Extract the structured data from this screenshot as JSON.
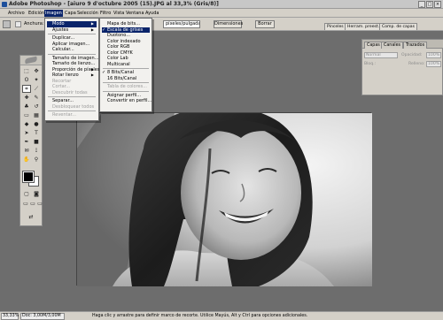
{
  "window": {
    "title": "Adobe Photoshop - [aiuro 9 d'octubre 2005 (15).JPG al 33,3% (Gris/8)]",
    "controls": [
      "_",
      "□",
      "×"
    ]
  },
  "menubar": [
    "Archivo",
    "Edición",
    "Imagen",
    "Capa",
    "Selección",
    "Filtro",
    "Vista",
    "Ventana",
    "Ayuda"
  ],
  "active_menu": "Imagen",
  "options_bar": {
    "anchura_label": "Anchura:",
    "resolution_unit": "píxeles/pulgada",
    "dimensions_button": "Dimensiones",
    "clear_button": "Borrar",
    "well_tabs": [
      "Pinceles",
      "Herram. preest.",
      "Comp. de capas"
    ]
  },
  "imagen_menu": [
    {
      "label": "Modo",
      "submenu": true,
      "highlighted": true
    },
    {
      "label": "Ajustes",
      "submenu": true
    },
    {
      "sep": true
    },
    {
      "label": "Duplicar..."
    },
    {
      "label": "Aplicar imagen..."
    },
    {
      "label": "Calcular..."
    },
    {
      "sep": true
    },
    {
      "label": "Tamaño de imagen..."
    },
    {
      "label": "Tamaño de lienzo..."
    },
    {
      "label": "Proporción de píxeles",
      "submenu": true
    },
    {
      "label": "Rotar lienzo",
      "submenu": true
    },
    {
      "label": "Recortar",
      "disabled": true
    },
    {
      "label": "Cortar...",
      "disabled": true
    },
    {
      "label": "Descubrir todas",
      "disabled": true
    },
    {
      "sep": true
    },
    {
      "label": "Separar..."
    },
    {
      "label": "Desbloquear todos",
      "disabled": true
    },
    {
      "sep": true
    },
    {
      "label": "Reventar...",
      "disabled": true
    }
  ],
  "modo_submenu": [
    {
      "label": "Mapa de bits..."
    },
    {
      "label": "Escala de grises",
      "checked": true,
      "highlighted": true
    },
    {
      "label": "Duotono..."
    },
    {
      "label": "Color indexado"
    },
    {
      "label": "Color RGB"
    },
    {
      "label": "Color CMYK"
    },
    {
      "label": "Color Lab"
    },
    {
      "label": "Multicanal"
    },
    {
      "sep": true
    },
    {
      "label": "8 Bits/Canal",
      "checked": true
    },
    {
      "label": "16 Bits/Canal"
    },
    {
      "sep": true
    },
    {
      "label": "Tabla de colores...",
      "disabled": true
    },
    {
      "sep": true
    },
    {
      "label": "Asignar perfil..."
    },
    {
      "label": "Convertir en perfil..."
    }
  ],
  "layers_panel": {
    "tabs": [
      "Capas",
      "Canales",
      "Trazados"
    ],
    "blend_mode": "Normal",
    "opacity_label": "Opacidad:",
    "opacity_value": "100%",
    "lock_label": "Bloq.:",
    "fill_label": "Relleno:",
    "fill_value": "100%"
  },
  "status": {
    "zoom": "33,33%",
    "doc_info": "Doc: 3,00M/3,00M",
    "hint": "Haga clic y arrastre para definir marco de recorte. Utilice Mayús, Alt y Ctrl para opciones adicionales."
  }
}
